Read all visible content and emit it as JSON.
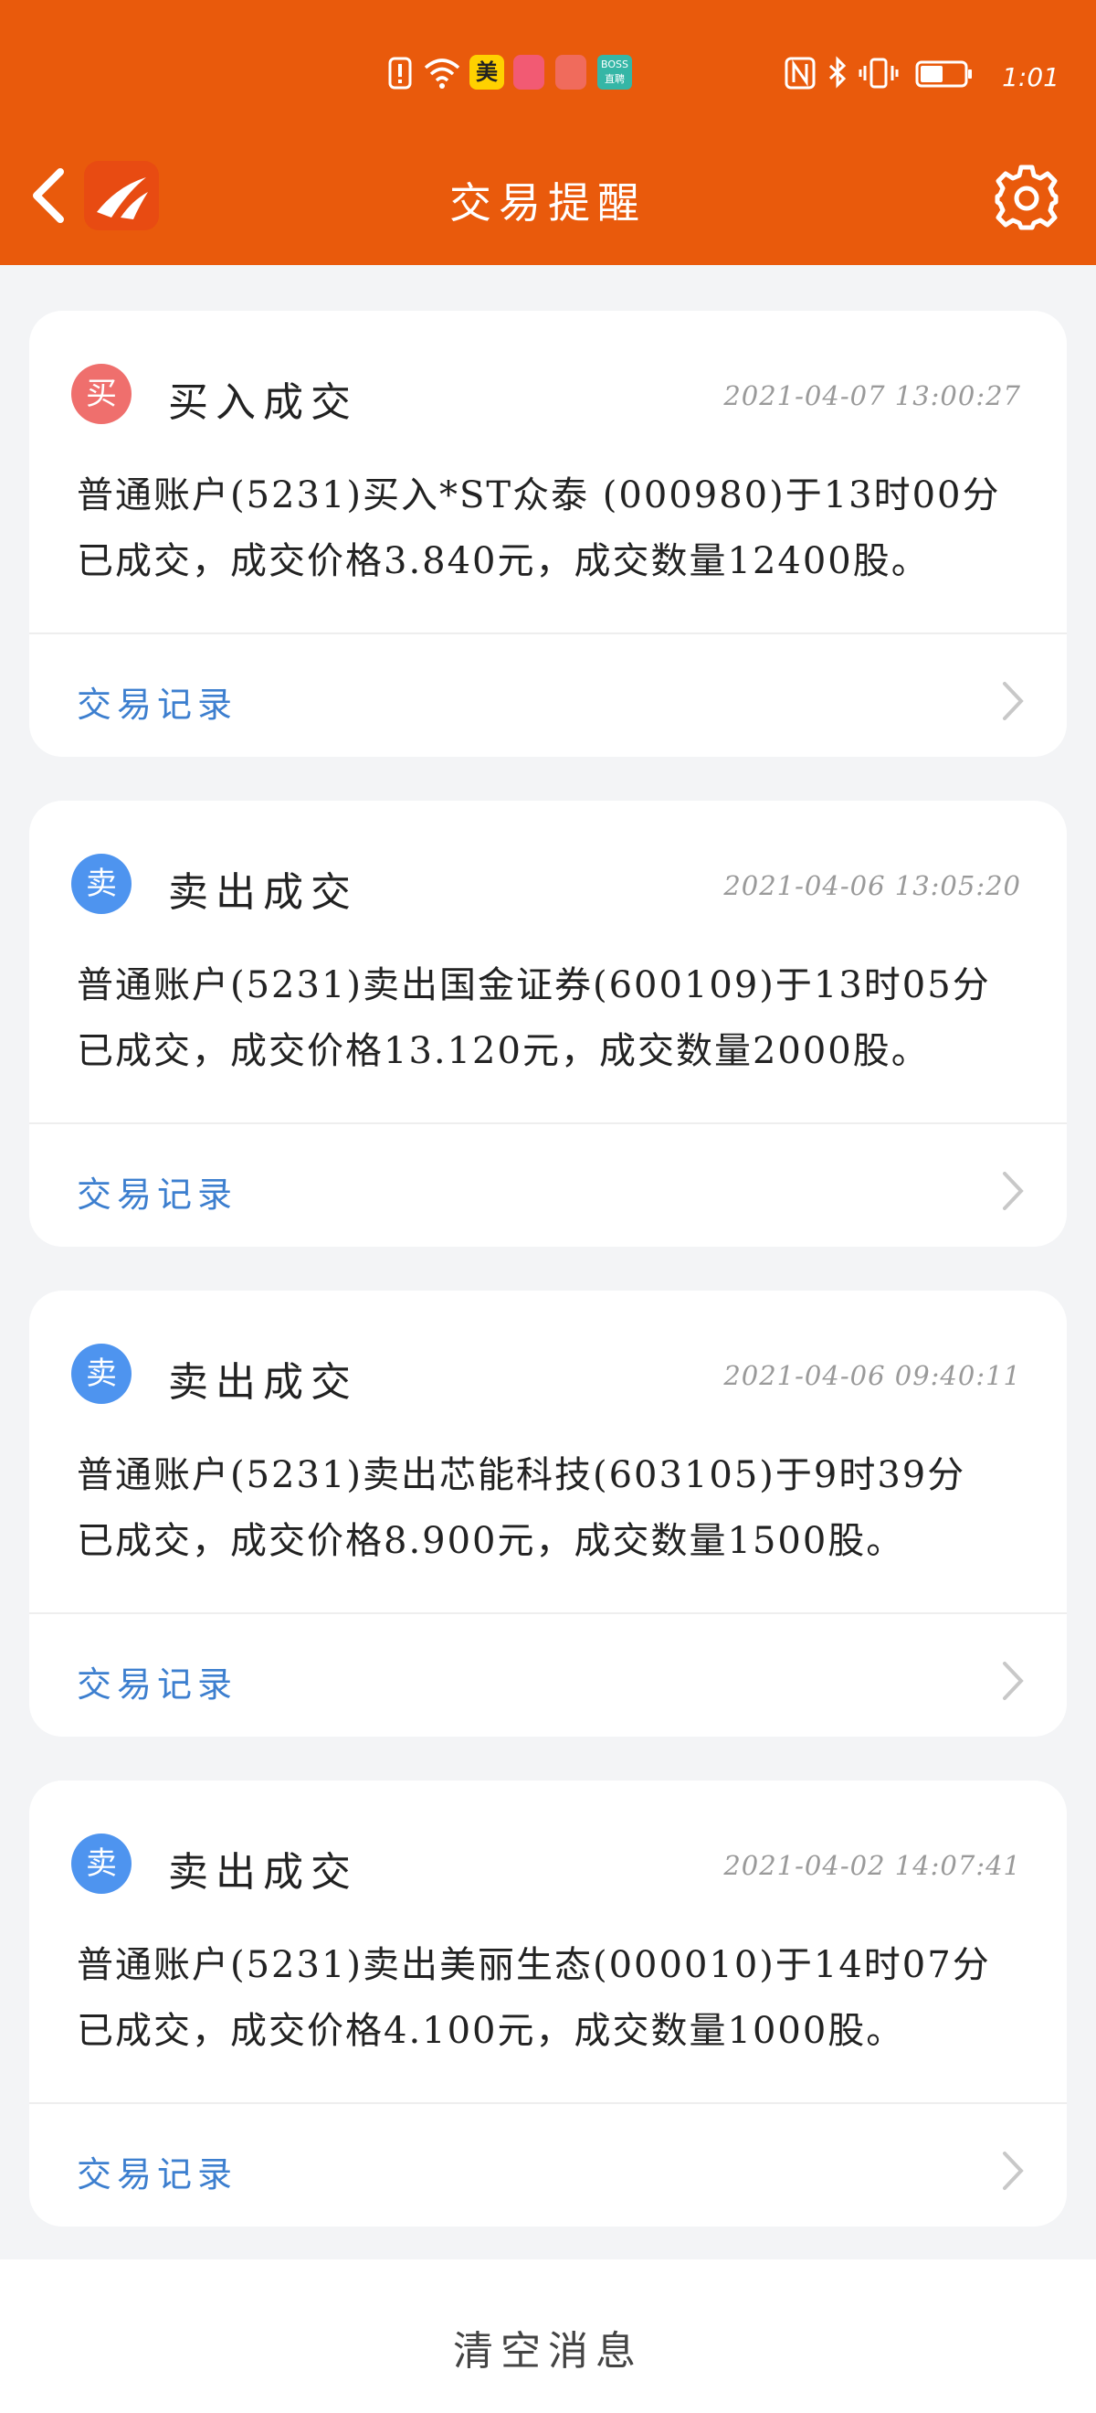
{
  "status_bar": {
    "time": "1:01",
    "icons": [
      "alert-icon",
      "wifi-icon",
      "meituan-icon",
      "huawei-mall-icon",
      "book-icon",
      "boss-zhipin-icon",
      "nfc-icon",
      "bluetooth-icon",
      "vibrate-icon",
      "battery-icon"
    ],
    "app_badges": {
      "meituan": "美",
      "boss_top": "BOSS",
      "boss_bottom": "直聘"
    }
  },
  "header": {
    "title": "交易提醒",
    "accent_color": "#e95a0c"
  },
  "cards": [
    {
      "badge": "买",
      "badge_color": "#ef6f6d",
      "title": "买入成交",
      "time": "2021-04-07 13:00:27",
      "line1": "普通账户(5231)买入*ST众泰 (000980)于13时00分",
      "line2": "已成交，成交价格3.840元，成交数量12400股。",
      "link": "交易记录"
    },
    {
      "badge": "卖",
      "badge_color": "#4e94ef",
      "title": "卖出成交",
      "time": "2021-04-06 13:05:20",
      "line1": "普通账户(5231)卖出国金证券(600109)于13时05分",
      "line2": "已成交，成交价格13.120元，成交数量2000股。",
      "link": "交易记录"
    },
    {
      "badge": "卖",
      "badge_color": "#4e94ef",
      "title": "卖出成交",
      "time": "2021-04-06 09:40:11",
      "line1": "普通账户(5231)卖出芯能科技(603105)于9时39分",
      "line2": "已成交，成交价格8.900元，成交数量1500股。",
      "link": "交易记录"
    },
    {
      "badge": "卖",
      "badge_color": "#4e94ef",
      "title": "卖出成交",
      "time": "2021-04-02 14:07:41",
      "line1": "普通账户(5231)卖出美丽生态(000010)于14时07分",
      "line2": "已成交，成交价格4.100元，成交数量1000股。",
      "link": "交易记录"
    }
  ],
  "footer": {
    "clear_label": "清空消息"
  }
}
